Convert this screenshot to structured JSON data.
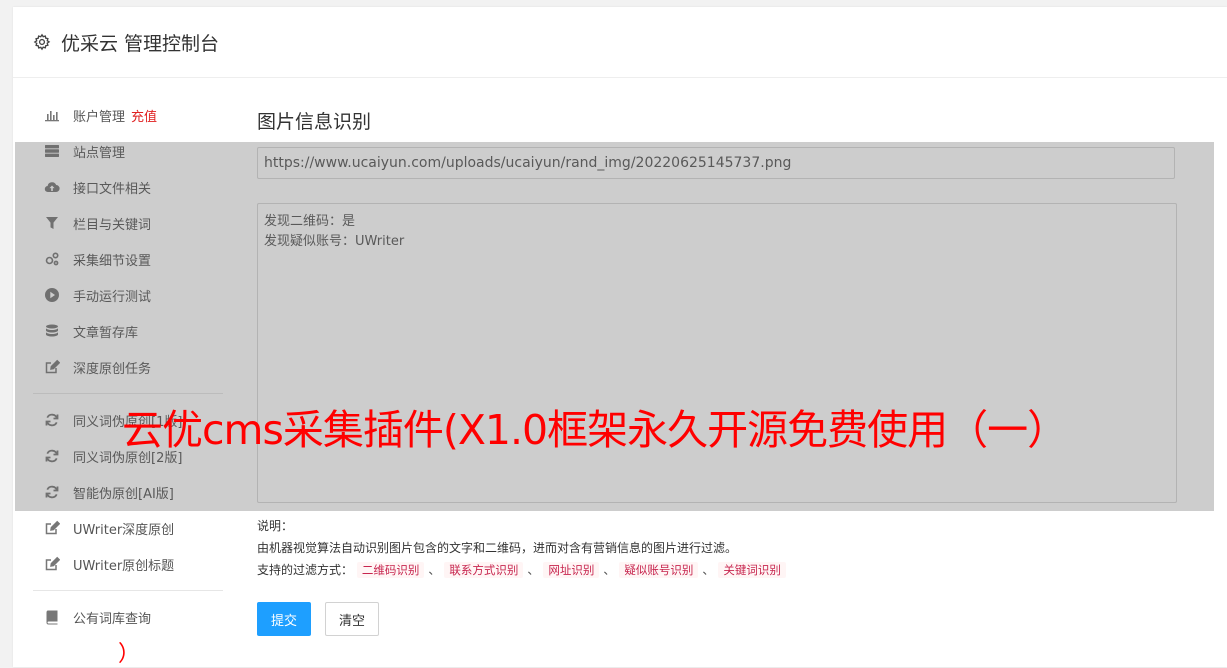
{
  "header": {
    "title": "优采云 管理控制台",
    "icon": "gear-icon"
  },
  "sidebar": {
    "items": [
      {
        "label": "账户管理",
        "badge": "充值",
        "icon": "bar-chart-icon"
      },
      {
        "label": "站点管理",
        "icon": "server-icon"
      },
      {
        "label": "接口文件相关",
        "icon": "cloud-upload-icon"
      },
      {
        "label": "栏目与关键词",
        "icon": "filter-icon"
      },
      {
        "label": "采集细节设置",
        "icon": "gears-icon"
      },
      {
        "label": "手动运行测试",
        "icon": "play-circle-icon"
      },
      {
        "label": "文章暂存库",
        "icon": "database-icon"
      },
      {
        "label": "深度原创任务",
        "icon": "edit-icon"
      },
      {
        "label": "同义词伪原创[1版]",
        "icon": "refresh-icon"
      },
      {
        "label": "同义词伪原创[2版]",
        "icon": "refresh-icon"
      },
      {
        "label": "智能伪原创[AI版]",
        "icon": "refresh-icon"
      },
      {
        "label": "UWriter深度原创",
        "icon": "edit-icon"
      },
      {
        "label": "UWriter原创标题",
        "icon": "edit-icon"
      },
      {
        "label": "公有词库查询",
        "icon": "book-icon"
      }
    ]
  },
  "main": {
    "title": "图片信息识别",
    "url_value": "https://www.ucaiyun.com/uploads/ucaiyun/rand_img/20220625145737.png",
    "result_text": "发现二维码：是\n发现疑似账号：UWriter",
    "notes": {
      "heading": "说明：",
      "line1": "由机器视觉算法自动识别图片包含的文字和二维码，进而对含有营销信息的图片进行过滤。",
      "filters_label": "支持的过滤方式：",
      "filters": [
        "二维码识别",
        "联系方式识别",
        "网址识别",
        "疑似账号识别",
        "关键词识别"
      ],
      "separator": "、"
    },
    "submit_label": "提交",
    "clear_label": "清空"
  },
  "watermark": {
    "text": "云优cms采集插件(X1.0框架永久开源免费使用（一）",
    "bottom_mark": "）"
  },
  "colors": {
    "primary": "#1e9fff",
    "badge": "#e02020",
    "watermark": "#ff0000",
    "tag": "#c7254e"
  }
}
